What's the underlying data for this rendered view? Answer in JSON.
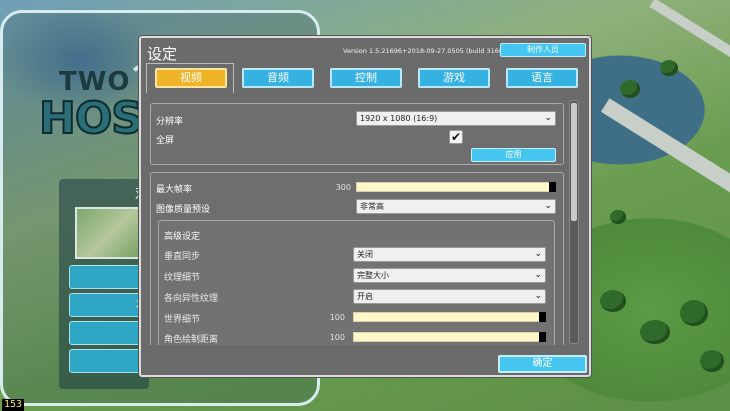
{
  "game": {
    "logo_top": "TWO",
    "logo_bottom": "HOS",
    "menu_title": "双",
    "menu_btn_2_char": "存",
    "fps": "153"
  },
  "dialog": {
    "title": "设定",
    "version": "Version 1.5.21696+2018-09-27.0505 (build 3160447)",
    "credits": "制作人员",
    "ok": "确定"
  },
  "tabs": [
    {
      "label": "视频",
      "active": true
    },
    {
      "label": "音频"
    },
    {
      "label": "控制"
    },
    {
      "label": "游戏"
    },
    {
      "label": "语言"
    }
  ],
  "display": {
    "resolution_label": "分辨率",
    "resolution_value": "1920 x 1080 (16:9)",
    "fullscreen_label": "全屏",
    "fullscreen_checked": true,
    "checkmark": "✔",
    "apply": "应用"
  },
  "quality": {
    "max_fps_label": "最大帧率",
    "max_fps_value": "300",
    "max_fps_level": 1.0,
    "preset_label": "图像质量预设",
    "preset_value": "非常高"
  },
  "advanced": {
    "title": "高级设定",
    "vsync_label": "垂直同步",
    "vsync_value": "关闭",
    "texture_label": "纹理细节",
    "texture_value": "完整大小",
    "aniso_label": "各向异性纹理",
    "aniso_value": "开启",
    "world_label": "世界细节",
    "world_value": "100",
    "world_level": 1.0,
    "char_label": "角色绘制距离",
    "char_value": "100",
    "char_level": 1.0
  },
  "icons": {
    "dropdown_chevron": "chevron-down-icon",
    "checkmark": "checkmark-icon"
  },
  "colors": {
    "tab_active": "#f0b428",
    "tab_inactive": "#35b2e2",
    "button": "#44c6f0",
    "dialog_bg": "#6b6b6b",
    "slider_fill": "#fff7c9"
  }
}
